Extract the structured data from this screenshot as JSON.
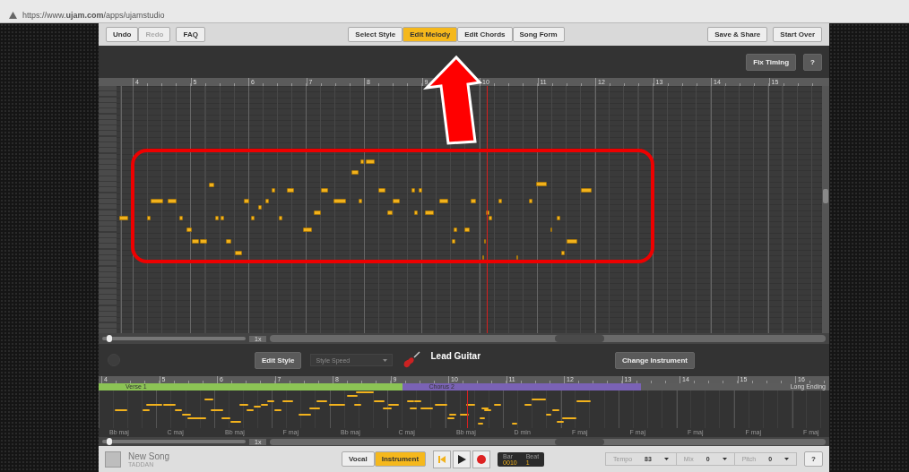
{
  "browser": {
    "url": "https://www.**ujam.com**/apps/ujamstudio"
  },
  "toolbar": {
    "history": [
      {
        "label": "Undo",
        "disabled": false
      },
      {
        "label": "Redo",
        "disabled": true
      }
    ],
    "faq": "FAQ",
    "modes": [
      {
        "label": "Select Style",
        "selected": false
      },
      {
        "label": "Edit Melody",
        "selected": true
      },
      {
        "label": "Edit Chords",
        "selected": false
      },
      {
        "label": "Song Form",
        "selected": false
      }
    ],
    "actions": [
      "Save & Share",
      "Start Over"
    ]
  },
  "editor": {
    "fix_timing": "Fix Timing",
    "help": "?",
    "ruler": [
      "4",
      "5",
      "6",
      "7",
      "8",
      "9",
      "10",
      "11",
      "12",
      "13",
      "14",
      "15"
    ],
    "zoom_slider": {
      "level": 0.05
    },
    "zoom": "1x"
  },
  "controls": {
    "edit_style": "Edit Style",
    "style_speed": {
      "placeholder": "Style Speed",
      "disabled": true
    },
    "instrument": "Lead Guitar",
    "change_instrument": "Change Instrument"
  },
  "overview": {
    "ruler": [
      "4",
      "5",
      "6",
      "7",
      "8",
      "9",
      "10",
      "11",
      "12",
      "13",
      "14",
      "15",
      "16"
    ],
    "sections": [
      {
        "label": "Verse 1",
        "color": "#8cc455"
      },
      {
        "label": "Chorus 2",
        "color": "#7a62b5"
      },
      {
        "label": "Long Ending",
        "color": "#5c5c5c"
      }
    ],
    "chords": [
      "Bb maj",
      "C maj",
      "Bb maj",
      "F maj",
      "Bb maj",
      "C maj",
      "Bb maj",
      "D min",
      "F maj",
      "F maj",
      "F maj",
      "F maj",
      "F maj"
    ],
    "zoom_slider": {
      "level": 0.05
    },
    "zoom": "1x"
  },
  "song": {
    "title": "New Song",
    "artist": "TADDAN"
  },
  "source": [
    {
      "label": "Vocal",
      "selected": false
    },
    {
      "label": "Instrument",
      "selected": true
    }
  ],
  "position": {
    "bar_label": "Bar",
    "beat_label": "Beat",
    "bar": "0010",
    "beat": "1"
  },
  "settings": [
    {
      "label": "Tempo",
      "value": "83"
    },
    {
      "label": "Mix",
      "value": "0"
    },
    {
      "label": "Pitch",
      "value": "0"
    }
  ],
  "help": "?"
}
